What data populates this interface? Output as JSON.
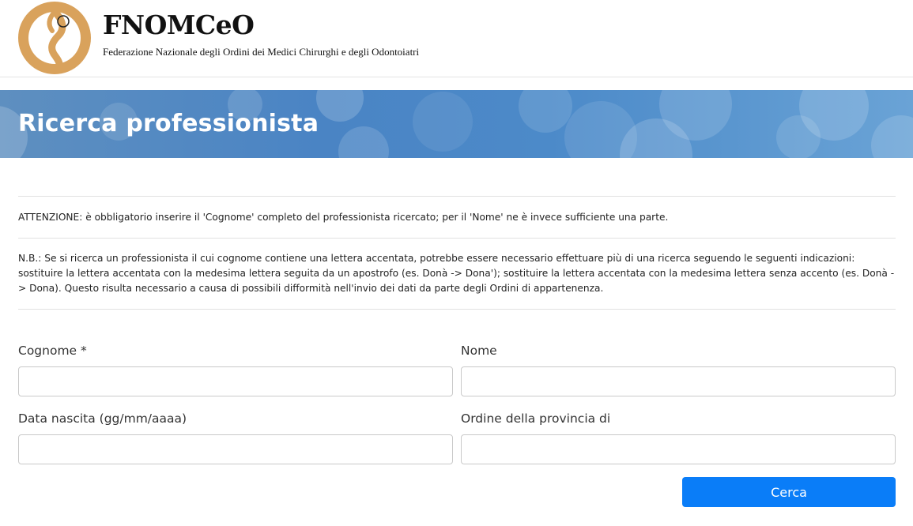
{
  "header": {
    "org_name": "FNOMCeO",
    "org_full_name": "Federazione Nazionale degli Ordini dei Medici Chirurghi e degli Odontoiatri",
    "logo_icon": "caduceus-snake-logo"
  },
  "hero": {
    "title": "Ricerca professionista"
  },
  "notes": {
    "attention": "ATTENZIONE: è obbligatorio inserire il 'Cognome' completo del professionista ricercato; per il 'Nome' ne è invece sufficiente una parte.",
    "nb": "N.B.: Se si ricerca un professionista il cui cognome contiene una lettera accentata, potrebbe essere necessario effettuare più di una ricerca seguendo le seguenti indicazioni: sostituire la lettera accentata con la medesima lettera seguita da un apostrofo (es. Donà -> Dona'); sostituire la lettera accentata con la medesima lettera senza accento (es. Donà -> Dona). Questo risulta necessario a causa di possibili difformità nell'invio dei dati da parte degli Ordini di appartenenza."
  },
  "form": {
    "surname_label": "Cognome *",
    "surname_value": "",
    "name_label": "Nome",
    "name_value": "",
    "birthdate_label": "Data nascita (gg/mm/aaaa)",
    "birthdate_value": "",
    "province_label": "Ordine della provincia di",
    "province_value": "",
    "search_label": "Cerca"
  },
  "colors": {
    "accent": "#0a7df8",
    "hero": "#4a84c4",
    "logo": "#d9a25c"
  }
}
